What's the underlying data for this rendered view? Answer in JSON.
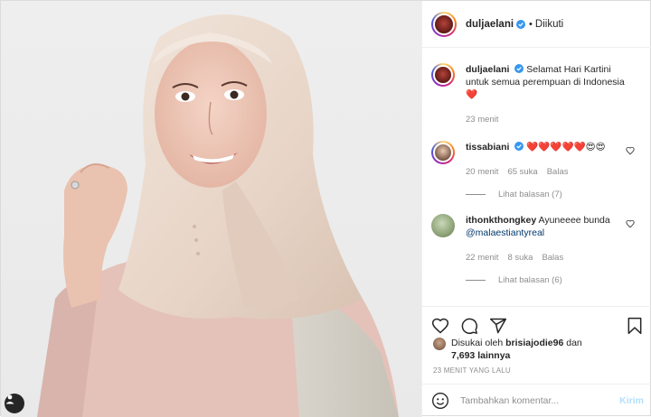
{
  "header": {
    "username": "duljaelani",
    "separator": "•",
    "follow_status": "Diikuti"
  },
  "caption": {
    "username": "duljaelani",
    "text": "Selamat Hari Kartini untuk semua perempuan di Indonesia",
    "emoji": "❤️",
    "time": "23 menit"
  },
  "comments": [
    {
      "username": "tissabiani",
      "text": "❤️❤️❤️❤️❤️😍😍",
      "time": "20 menit",
      "likes": "65 suka",
      "reply_label": "Balas",
      "view_replies": "Lihat balasan (7)"
    },
    {
      "username": "ithonkthongkey",
      "text": "Ayuneeee bunda",
      "mention": "@malaestiantyreal",
      "time": "22 menit",
      "likes": "8 suka",
      "reply_label": "Balas",
      "view_replies": "Lihat balasan (6)"
    }
  ],
  "likes": {
    "prefix": "Disukai oleh",
    "user": "brisiajodie96",
    "mid": "dan",
    "count": "7,693 lainnya"
  },
  "timestamp": "23 MENIT YANG LALU",
  "add_comment": {
    "placeholder": "Tambahkan komentar...",
    "post_label": "Kirim"
  },
  "icons": {
    "like": "heart-icon",
    "comment": "comment-icon",
    "share": "share-icon",
    "save": "bookmark-icon",
    "emoji": "smiley-icon",
    "user_tag": "user-tag-icon"
  },
  "colors": {
    "verified": "#3897f0",
    "heart": "#ed4956",
    "link": "#00376b",
    "muted": "#8e8e8e",
    "post_disabled": "#b2dffc"
  }
}
